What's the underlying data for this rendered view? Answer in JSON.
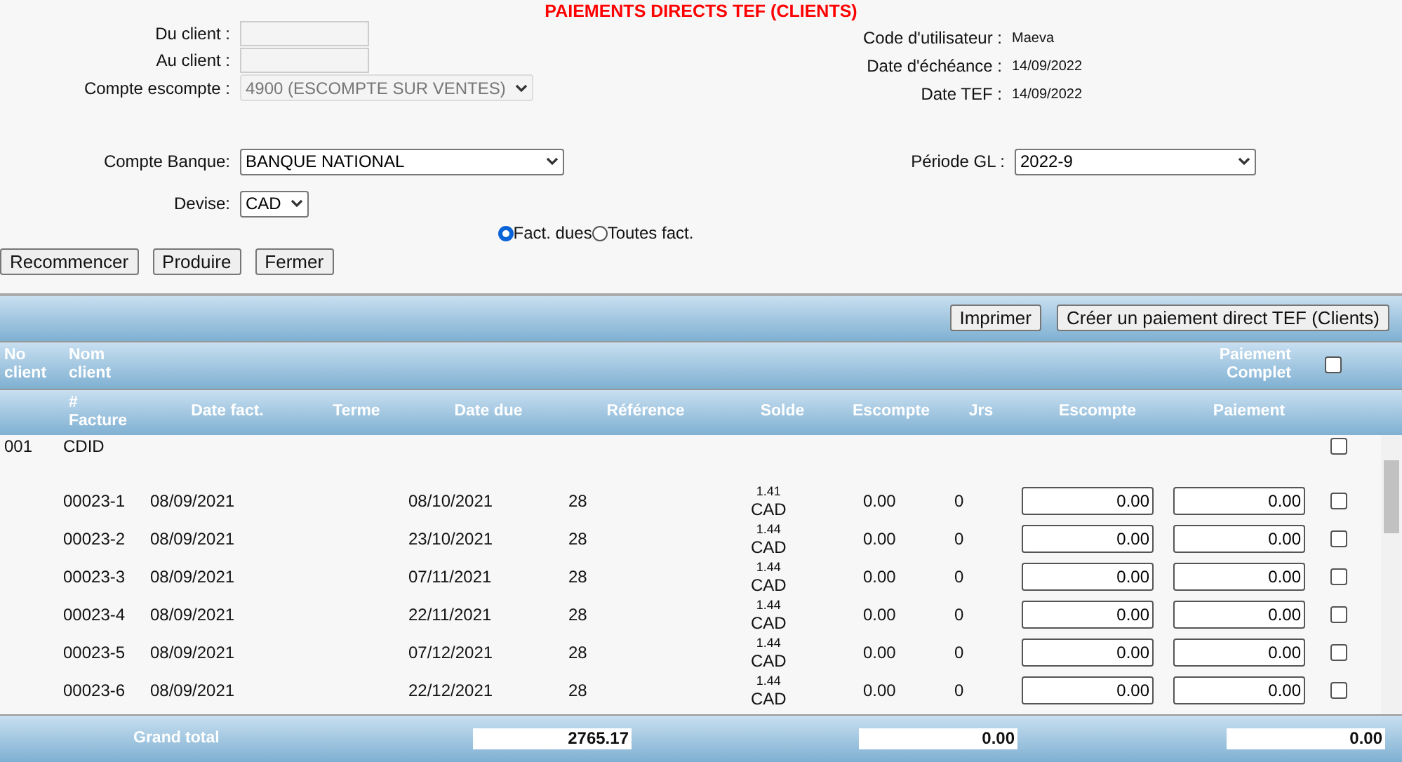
{
  "title": "PAIEMENTS DIRECTS TEF (CLIENTS)",
  "left_fields": [
    {
      "label": "Du client :",
      "kind": "text"
    },
    {
      "label": "Au client :",
      "kind": "text"
    },
    {
      "label": "Compte escompte :",
      "kind": "select",
      "value": "4900 (ESCOMPTE SUR VENTES)",
      "disabled": true
    }
  ],
  "right_info": [
    {
      "label": "Code d'utilisateur :",
      "value": "Maeva"
    },
    {
      "label": "Date d'échéance :",
      "value": "14/09/2022"
    },
    {
      "label": "Date TEF :",
      "value": "14/09/2022"
    }
  ],
  "bank": {
    "label": "Compte Banque:",
    "value": "BANQUE NATIONAL"
  },
  "period": {
    "label": "Période GL :",
    "value": "2022-9"
  },
  "currency": {
    "label": "Devise:",
    "value": "CAD"
  },
  "invoice_filter": [
    {
      "label": "Fact. dues",
      "selected": true
    },
    {
      "label": "Toutes fact.",
      "selected": false
    }
  ],
  "buttons": [
    "Recommencer",
    "Produire",
    "Fermer"
  ],
  "toolbar_buttons": [
    "Imprimer",
    "Créer un paiement direct TEF (Clients)"
  ],
  "table": {
    "group_columns": [
      "No client",
      "Nom client",
      "Paiement Complet"
    ],
    "all_checked": false,
    "columns": [
      "# Facture",
      "Date fact.",
      "Terme",
      "Date due",
      "Référence",
      "Solde",
      "Escompte",
      "Jrs",
      "Escompte",
      "Paiement"
    ],
    "client": {
      "number": "001",
      "name": "CDID",
      "checked": false
    },
    "rows": [
      {
        "invoice": "00023-1",
        "date": "08/09/2021",
        "due": "08/10/2021",
        "reference": "28",
        "balance": "1.41",
        "currency": "CAD",
        "discount": "0.00",
        "days": "0",
        "discount_input": "0.00",
        "payment": "0.00",
        "checked": false
      },
      {
        "invoice": "00023-2",
        "date": "08/09/2021",
        "due": "23/10/2021",
        "reference": "28",
        "balance": "1.44",
        "currency": "CAD",
        "discount": "0.00",
        "days": "0",
        "discount_input": "0.00",
        "payment": "0.00",
        "checked": false
      },
      {
        "invoice": "00023-3",
        "date": "08/09/2021",
        "due": "07/11/2021",
        "reference": "28",
        "balance": "1.44",
        "currency": "CAD",
        "discount": "0.00",
        "days": "0",
        "discount_input": "0.00",
        "payment": "0.00",
        "checked": false
      },
      {
        "invoice": "00023-4",
        "date": "08/09/2021",
        "due": "22/11/2021",
        "reference": "28",
        "balance": "1.44",
        "currency": "CAD",
        "discount": "0.00",
        "days": "0",
        "discount_input": "0.00",
        "payment": "0.00",
        "checked": false
      },
      {
        "invoice": "00023-5",
        "date": "08/09/2021",
        "due": "07/12/2021",
        "reference": "28",
        "balance": "1.44",
        "currency": "CAD",
        "discount": "0.00",
        "days": "0",
        "discount_input": "0.00",
        "payment": "0.00",
        "checked": false
      },
      {
        "invoice": "00023-6",
        "date": "08/09/2021",
        "due": "22/12/2021",
        "reference": "28",
        "balance": "1.44",
        "currency": "CAD",
        "discount": "0.00",
        "days": "0",
        "discount_input": "0.00",
        "payment": "0.00",
        "checked": false
      }
    ],
    "totals": {
      "label": "Grand total",
      "balance": "2765.17",
      "discount": "0.00",
      "payment": "0.00"
    }
  }
}
